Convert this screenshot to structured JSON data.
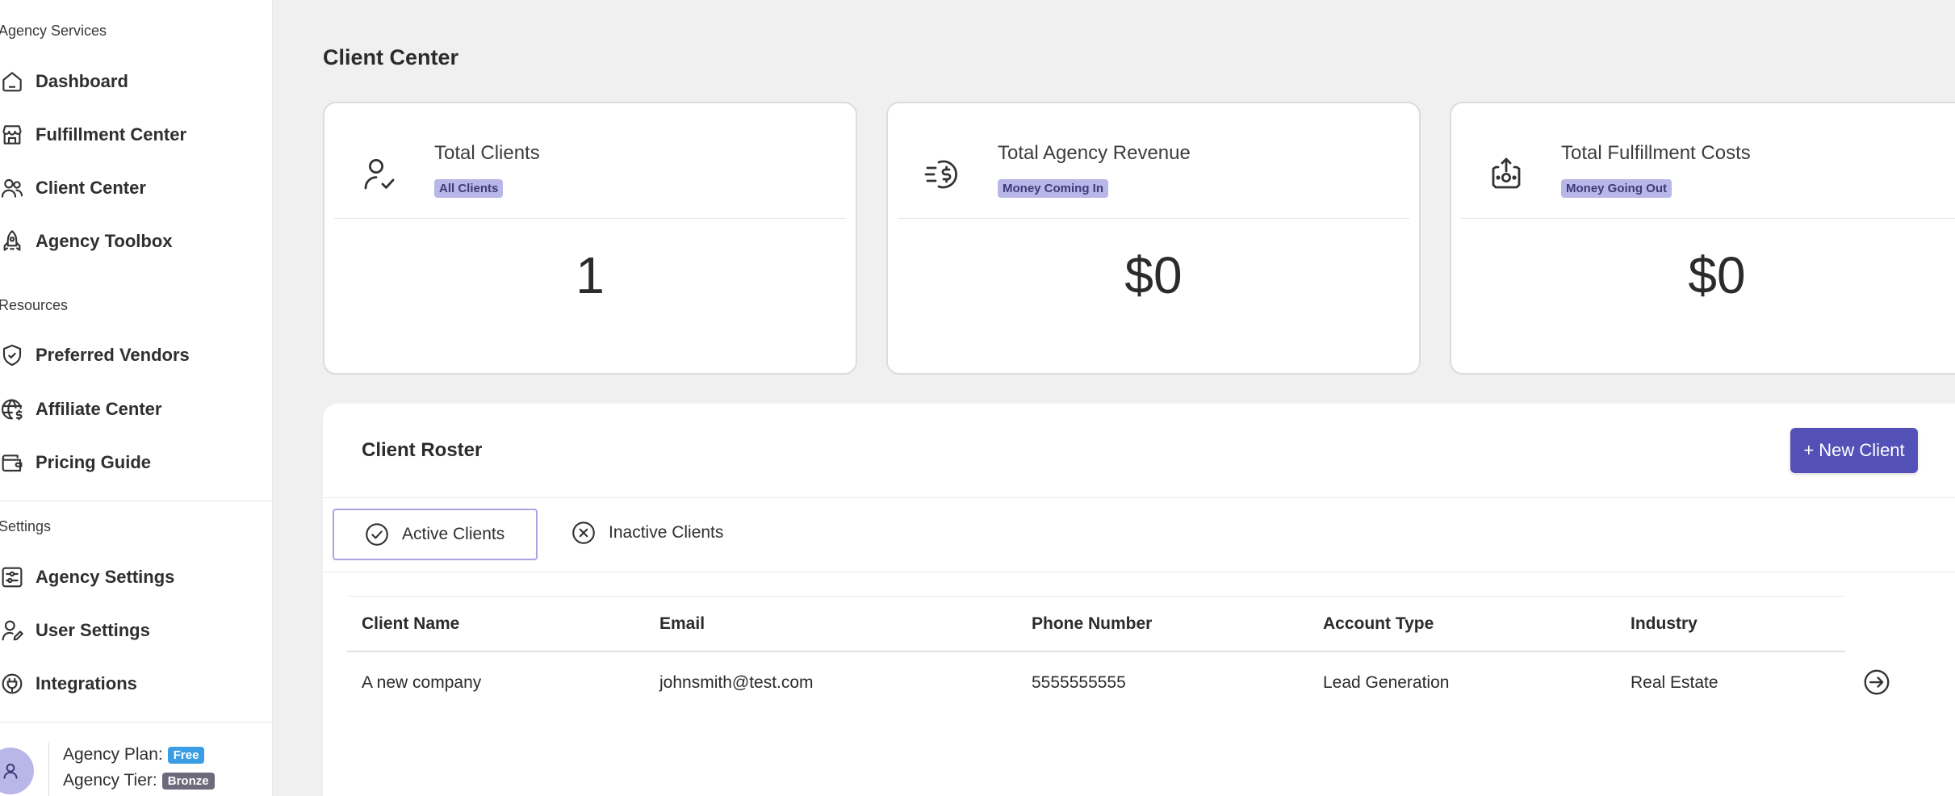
{
  "sidebar": {
    "sections": {
      "agency_services": "Agency Services",
      "resources": "Resources",
      "settings": "Settings"
    },
    "items": [
      {
        "label": "Dashboard",
        "icon": "home-icon"
      },
      {
        "label": "Fulfillment Center",
        "icon": "store-icon"
      },
      {
        "label": "Client Center",
        "icon": "users-icon"
      },
      {
        "label": "Agency Toolbox",
        "icon": "rocket-icon"
      },
      {
        "label": "Preferred Vendors",
        "icon": "shield-check-icon"
      },
      {
        "label": "Affiliate Center",
        "icon": "globe-dollar-icon"
      },
      {
        "label": "Pricing Guide",
        "icon": "wallet-icon"
      },
      {
        "label": "Agency Settings",
        "icon": "sliders-icon"
      },
      {
        "label": "User Settings",
        "icon": "user-edit-icon"
      },
      {
        "label": "Integrations",
        "icon": "plug-icon"
      }
    ],
    "plan": {
      "plan_label": "Agency Plan:",
      "plan_value": "Free",
      "tier_label": "Agency Tier:",
      "tier_value": "Bronze"
    }
  },
  "main": {
    "title": "Client Center",
    "cards": [
      {
        "title": "Total Clients",
        "badge": "All Clients",
        "value": "1",
        "icon": "user-check-icon"
      },
      {
        "title": "Total Agency Revenue",
        "badge": "Money Coming In",
        "value": "$0",
        "icon": "coin-dollar-icon"
      },
      {
        "title": "Total Fulfillment Costs",
        "badge": "Money Going Out",
        "value": "$0",
        "icon": "money-out-icon"
      }
    ],
    "roster": {
      "title": "Client Roster",
      "new_button": "+ New Client",
      "tabs": {
        "active": "Active Clients",
        "inactive": "Inactive Clients"
      },
      "columns": [
        "Client Name",
        "Email",
        "Phone Number",
        "Account Type",
        "Industry"
      ],
      "rows": [
        [
          "A new company",
          "johnsmith@test.com",
          "5555555555",
          "Lead Generation",
          "Real Estate"
        ]
      ]
    }
  },
  "colors": {
    "accent": "#5350b7",
    "badge_purple": "#b9b6e8",
    "badge_free": "#3b9ee4",
    "badge_bronze": "#6b6b7b"
  }
}
